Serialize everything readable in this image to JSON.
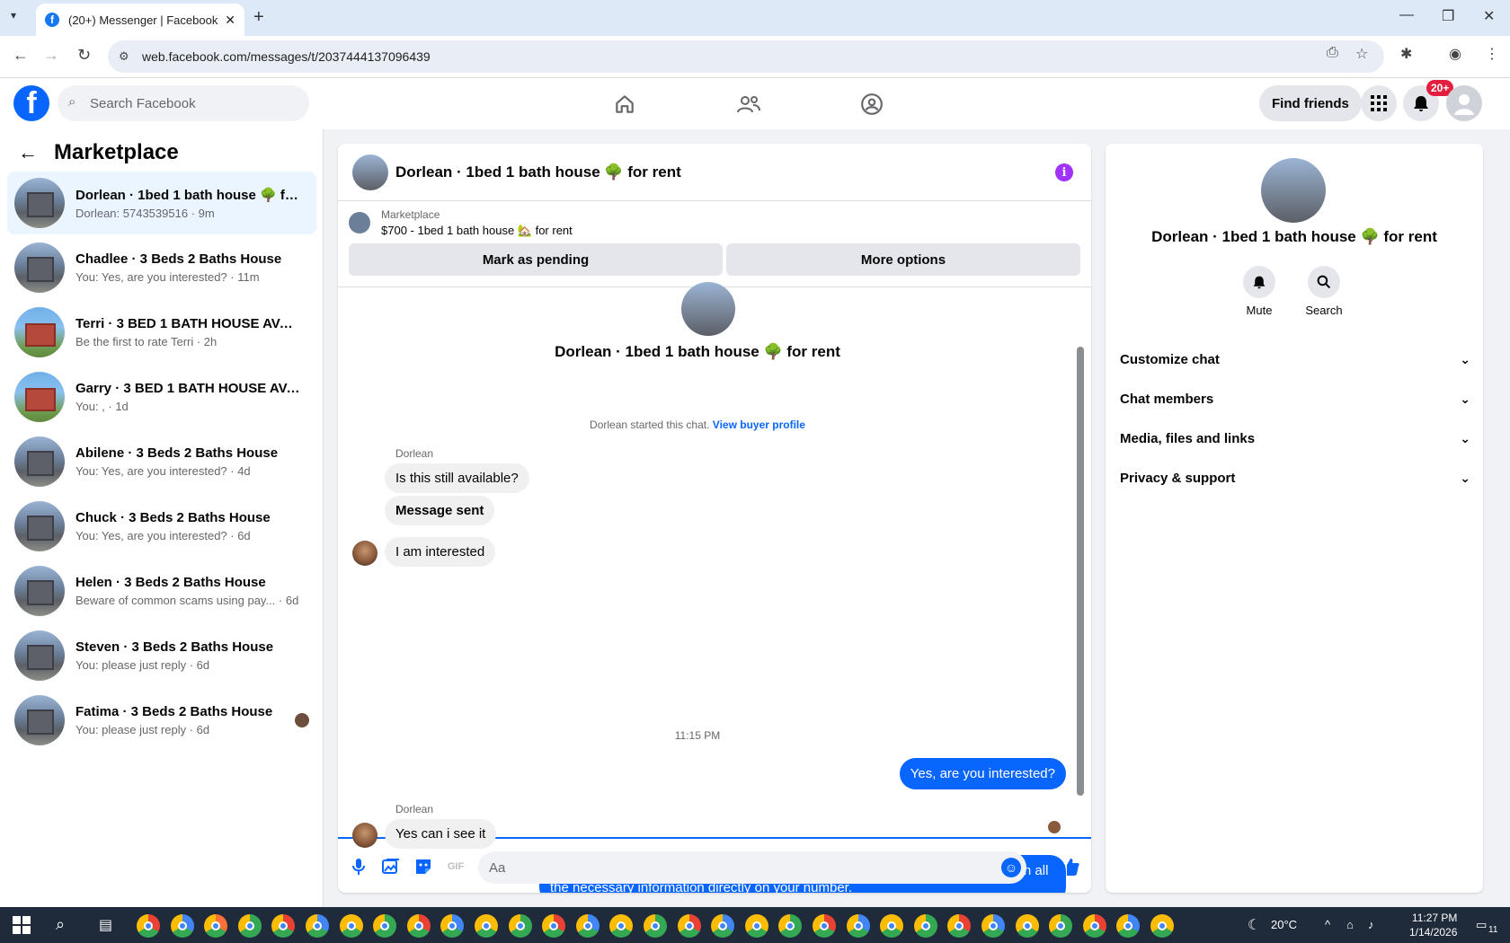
{
  "browser": {
    "tab_title": "(20+) Messenger | Facebook",
    "tab_close": "✕",
    "new_tab": "+",
    "url": "web.facebook.com/messages/t/2037444137096439"
  },
  "fb": {
    "logo": "f",
    "search_placeholder": "Search Facebook",
    "find_friends": "Find friends",
    "notif_count": "20+"
  },
  "left": {
    "title": "Marketplace",
    "conversations": [
      {
        "name": "Dorlean · 1bed 1 bath house 🌳 for rent",
        "sub": "Dorlean: 5743539516 · 9m"
      },
      {
        "name": "Chadlee · 3 Beds 2 Baths House",
        "sub": "You: Yes, are you interested? · 11m"
      },
      {
        "name": "Terri · 3 BED 1 BATH HOUSE AVAILABLE",
        "sub": "Be the first to rate Terri · 2h"
      },
      {
        "name": "Garry · 3 BED 1 BATH HOUSE AVAILABLE",
        "sub": "You: , · 1d"
      },
      {
        "name": "Abilene · 3 Beds 2 Baths House",
        "sub": "You: Yes, are you interested? · 4d"
      },
      {
        "name": "Chuck · 3 Beds 2 Baths House",
        "sub": "You: Yes, are you interested? · 6d"
      },
      {
        "name": "Helen · 3 Beds 2 Baths House",
        "sub": "Beware of common scams using pay... · 6d"
      },
      {
        "name": "Steven · 3 Beds 2 Baths House",
        "sub": "You: please just reply · 6d"
      },
      {
        "name": "Fatima · 3 Beds 2 Baths House",
        "sub": "You: please just reply · 6d"
      }
    ]
  },
  "chat": {
    "title": "Dorlean · 1bed 1 bath house 🌳 for rent",
    "listing_source": "Marketplace",
    "listing_price": "$700 - 1bed 1 bath house 🏡 for rent",
    "mark_pending": "Mark as pending",
    "more_options": "More options",
    "thread_title": "Dorlean · 1bed 1 bath house 🌳 for rent",
    "started": "Dorlean started this chat.",
    "buyer_profile": "View buyer profile",
    "sender_name": "Dorlean",
    "messages": {
      "m1": "Is this still available?",
      "m2": "Message sent",
      "m3": "I am interested",
      "time": "11:15 PM",
      "o1": "Yes, are you interested?",
      "m4": "Yes can i see it",
      "o2": "Kindly share your contact number with us, and we will ensure to provide you with all the necessary information directly on your number.",
      "m5": "5743539516"
    },
    "composer_placeholder": "Aa",
    "gif_label": "GIF"
  },
  "right": {
    "title": "Dorlean · 1bed 1 bath house 🌳 for rent",
    "mute": "Mute",
    "search": "Search",
    "rows": [
      "Customize chat",
      "Chat members",
      "Media, files and links",
      "Privacy & support"
    ]
  },
  "taskbar": {
    "weather": "20°C",
    "time": "11:27 PM",
    "date": "1/14/2026",
    "notif": "11"
  },
  "colors": {
    "accent": "#0866ff",
    "info_purple": "#a033ff",
    "badge_red": "#e41e3f"
  }
}
